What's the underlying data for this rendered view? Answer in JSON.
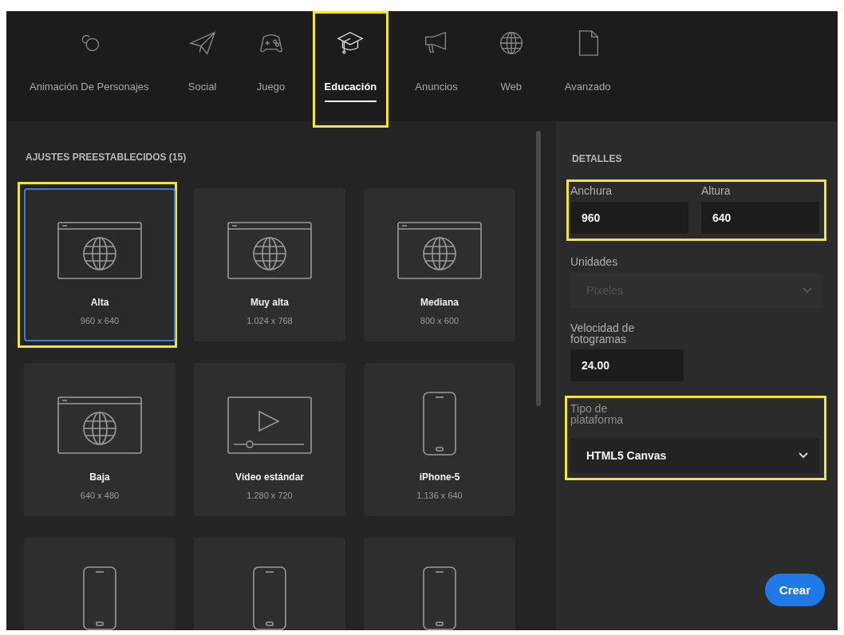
{
  "tabs": [
    {
      "label": "Animación De Personajes",
      "selected": false,
      "highlighted": false
    },
    {
      "label": "Social",
      "selected": false,
      "highlighted": false
    },
    {
      "label": "Juego",
      "selected": false,
      "highlighted": false
    },
    {
      "label": "Educación",
      "selected": true,
      "highlighted": true
    },
    {
      "label": "Anuncios",
      "selected": false,
      "highlighted": false
    },
    {
      "label": "Web",
      "selected": false,
      "highlighted": false
    },
    {
      "label": "Avanzado",
      "selected": false,
      "highlighted": false
    }
  ],
  "presets": {
    "title": "AJUSTES PREESTABLECIDOS (15)",
    "items": [
      {
        "kind": "web",
        "name": "Alta",
        "size": "960 x 640",
        "selected": true,
        "highlighted": true
      },
      {
        "kind": "web",
        "name": "Muy alta",
        "size": "1.024 x 768",
        "selected": false,
        "highlighted": false
      },
      {
        "kind": "web",
        "name": "Mediana",
        "size": "800 x 600",
        "selected": false,
        "highlighted": false
      },
      {
        "kind": "web",
        "name": "Baja",
        "size": "640 x 480",
        "selected": false,
        "highlighted": false
      },
      {
        "kind": "video",
        "name": "Vídeo estándar",
        "size": "1.280 x 720",
        "selected": false,
        "highlighted": false
      },
      {
        "kind": "phone",
        "name": "iPhone-5",
        "size": "1.136 x 640",
        "selected": false,
        "highlighted": false
      },
      {
        "kind": "phone",
        "selected": false,
        "highlighted": false
      },
      {
        "kind": "phone",
        "selected": false,
        "highlighted": false
      },
      {
        "kind": "phone",
        "selected": false,
        "highlighted": false
      }
    ]
  },
  "details": {
    "title": "DETALLES",
    "dimensions": {
      "highlighted": true,
      "fields": [
        {
          "label": "Anchura",
          "value": "960"
        },
        {
          "label": "Altura",
          "value": "640"
        }
      ]
    },
    "units": {
      "label": "Unidades",
      "value": "Píxeles",
      "disabled": true
    },
    "frame_rate": {
      "label": "Velocidad de fotogramas",
      "value": "24.00"
    },
    "platform": {
      "label": "Tipo de plataforma",
      "value": "HTML5 Canvas",
      "highlighted": true
    },
    "button": "Crear"
  }
}
